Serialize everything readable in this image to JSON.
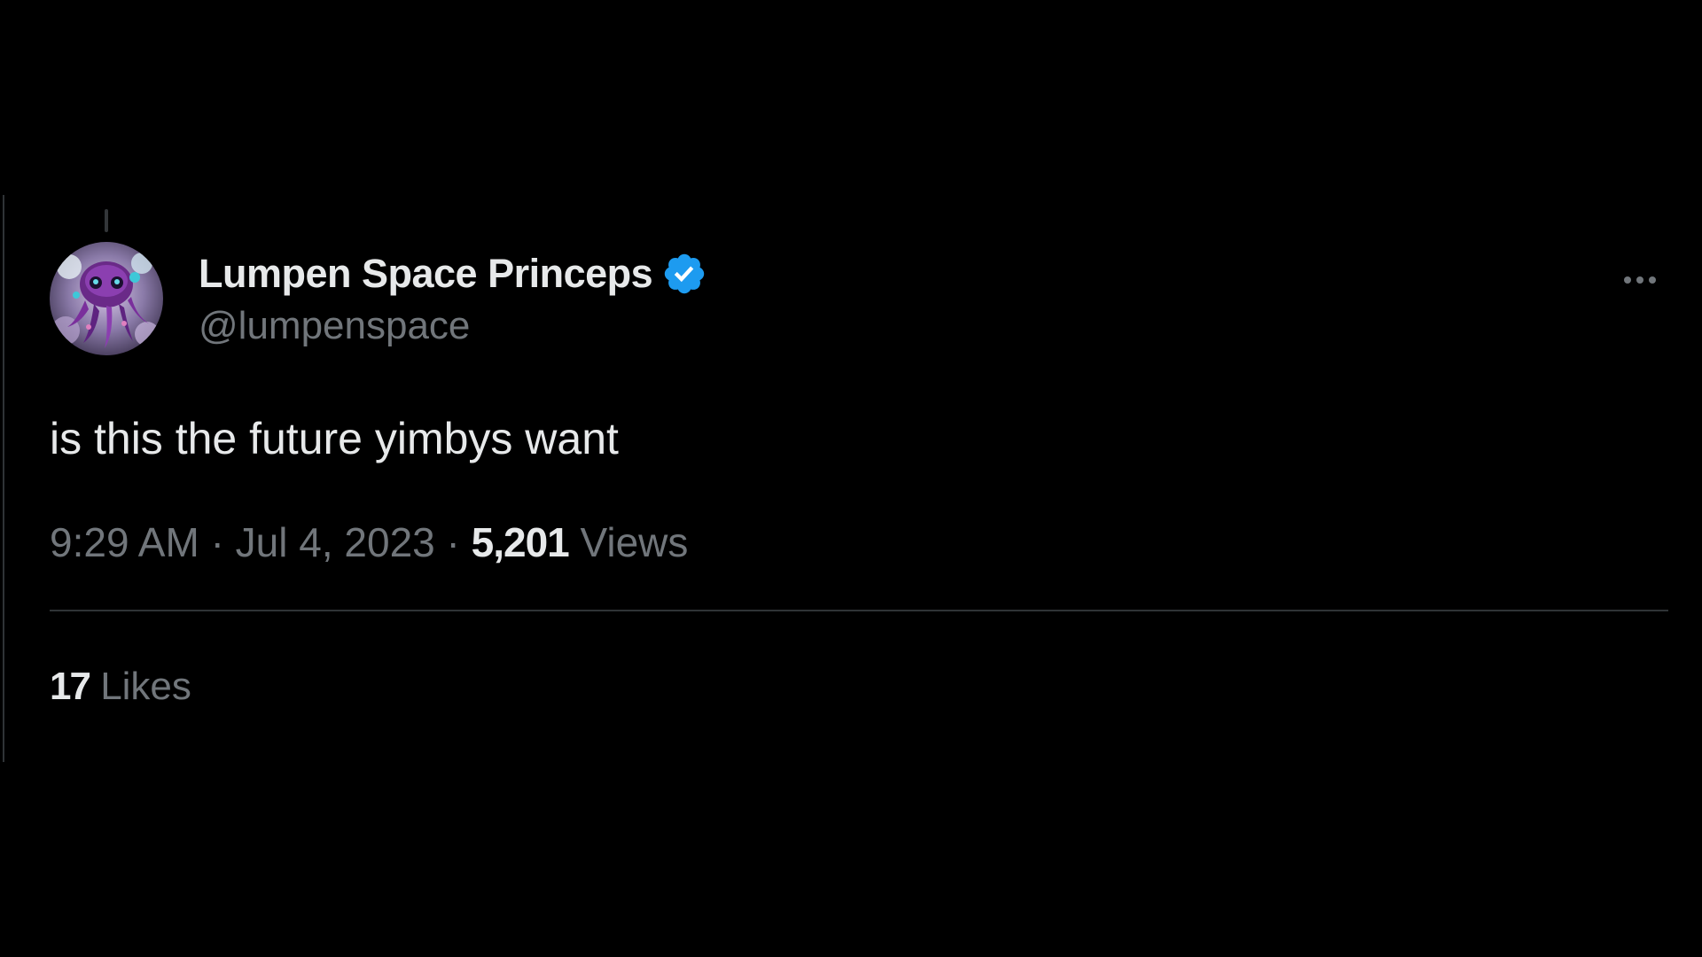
{
  "author": {
    "display_name": "Lumpen Space Princeps",
    "handle": "@lumpenspace",
    "verified": true,
    "verified_icon": "verified-badge-icon",
    "verified_color": "#1d9bf0",
    "avatar_icon": "octopus-avatar"
  },
  "tweet": {
    "text": "is this the future yimbys want",
    "time": "9:29 AM",
    "separator": "·",
    "date": "Jul 4, 2023",
    "views_count": "5,201",
    "views_label": "Views"
  },
  "stats": {
    "likes_count": "17",
    "likes_label": "Likes"
  },
  "menu": {
    "more_icon": "more-horizontal-icon"
  },
  "colors": {
    "background": "#000000",
    "primary_text": "#e7e9ea",
    "secondary_text": "#71767b",
    "divider": "#2f3336"
  }
}
